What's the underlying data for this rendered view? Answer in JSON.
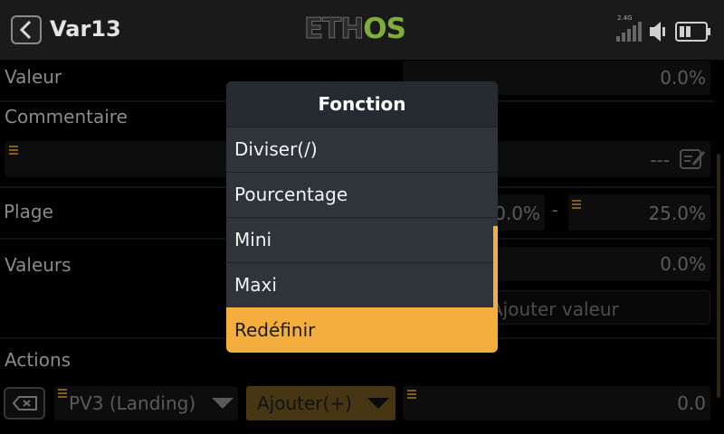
{
  "header": {
    "title": "Var13",
    "logo_main": "ETH",
    "logo_accent": "OS",
    "radio_band": "2.4G"
  },
  "rows": {
    "valeur": {
      "label": "Valeur",
      "value": "0.0%"
    },
    "commentaire": {
      "label": "Commentaire",
      "value": "---"
    },
    "plage": {
      "label": "Plage",
      "min": "0.0%",
      "sep": "-",
      "max": "25.0%"
    },
    "valeurs": {
      "label": "Valeurs",
      "value": "0.0%",
      "add_label": "Ajouter valeur"
    },
    "actions": {
      "label": "Actions",
      "source": "PV3 (Landing)",
      "op": "Ajouter(+)",
      "value": "0.0"
    }
  },
  "dialog": {
    "title": "Fonction",
    "items": [
      {
        "label": "Diviser(/)"
      },
      {
        "label": "Pourcentage"
      },
      {
        "label": "Mini"
      },
      {
        "label": "Maxi"
      },
      {
        "label": "Redéfinir",
        "selected": true
      }
    ]
  },
  "colors": {
    "accent": "#f4ae3d",
    "handle": "#c8902a",
    "logo_green": "#7fae38"
  }
}
